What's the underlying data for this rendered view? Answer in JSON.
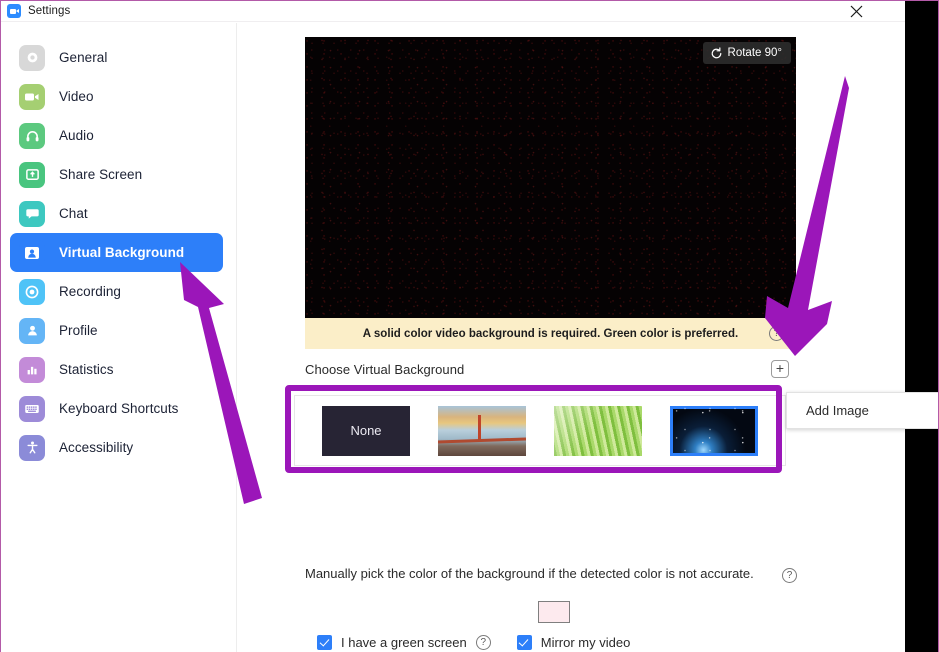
{
  "window": {
    "title": "Settings",
    "app_icon": "zoom-camera-icon",
    "close_icon": "close-icon"
  },
  "sidebar": {
    "items": [
      {
        "label": "General",
        "icon": "gear-icon",
        "color": "#d8d8d8",
        "active": false
      },
      {
        "label": "Video",
        "icon": "video-camera-icon",
        "color": "#a5cf72",
        "active": false
      },
      {
        "label": "Audio",
        "icon": "headphones-icon",
        "color": "#5cc97f",
        "active": false
      },
      {
        "label": "Share Screen",
        "icon": "share-screen-icon",
        "color": "#49c57f",
        "active": false
      },
      {
        "label": "Chat",
        "icon": "chat-bubble-icon",
        "color": "#3dc8c0",
        "active": false
      },
      {
        "label": "Virtual Background",
        "icon": "person-card-icon",
        "color": "#2d7ff9",
        "active": true
      },
      {
        "label": "Recording",
        "icon": "record-circle-icon",
        "color": "#4fc3f7",
        "active": false
      },
      {
        "label": "Profile",
        "icon": "person-icon",
        "color": "#64b5f6",
        "active": false
      },
      {
        "label": "Statistics",
        "icon": "bar-chart-icon",
        "color": "#c38bd8",
        "active": false
      },
      {
        "label": "Keyboard Shortcuts",
        "icon": "keyboard-icon",
        "color": "#9d8bd8",
        "active": false
      },
      {
        "label": "Accessibility",
        "icon": "accessibility-icon",
        "color": "#8b8bd8",
        "active": false
      }
    ]
  },
  "main": {
    "video_preview": {
      "rotate_button_label": "Rotate 90°",
      "rotate_icon": "rotate-ccw-icon"
    },
    "warning": {
      "text": "A solid color video background is required. Green color is preferred.",
      "help_icon_label": "?",
      "background_color": "#fbeec8"
    },
    "choose_section": {
      "label": "Choose Virtual Background",
      "add_button_label": "+",
      "add_button_icon": "plus-circle-icon"
    },
    "thumbnails": [
      {
        "name": "None",
        "label": "None",
        "selected": false,
        "style": "none"
      },
      {
        "name": "Golden Gate Bridge",
        "label": "",
        "selected": false,
        "style": "bridge"
      },
      {
        "name": "Grass",
        "label": "",
        "selected": false,
        "style": "grass"
      },
      {
        "name": "Earth from space",
        "label": "",
        "selected": true,
        "style": "earth"
      }
    ],
    "manual_color": {
      "text": "Manually pick the color of the background if the detected color is not accurate.",
      "help_icon_label": "?",
      "swatch_color": "#fdeaee"
    },
    "checkboxes": [
      {
        "label": "I have a green screen",
        "checked": true,
        "has_help": true,
        "help_icon_label": "?"
      },
      {
        "label": "Mirror my video",
        "checked": true,
        "has_help": false,
        "help_icon_label": ""
      }
    ]
  },
  "add_image_menu": {
    "label": "Add Image",
    "visible": true
  },
  "annotations": {
    "highlight_color": "#9b16b9",
    "arrow_color": "#9b16b9",
    "arrow_sidebar_target": "Virtual Background",
    "arrow_plus_target": "Add Image plus button",
    "frame_color": "#b35aa8"
  }
}
